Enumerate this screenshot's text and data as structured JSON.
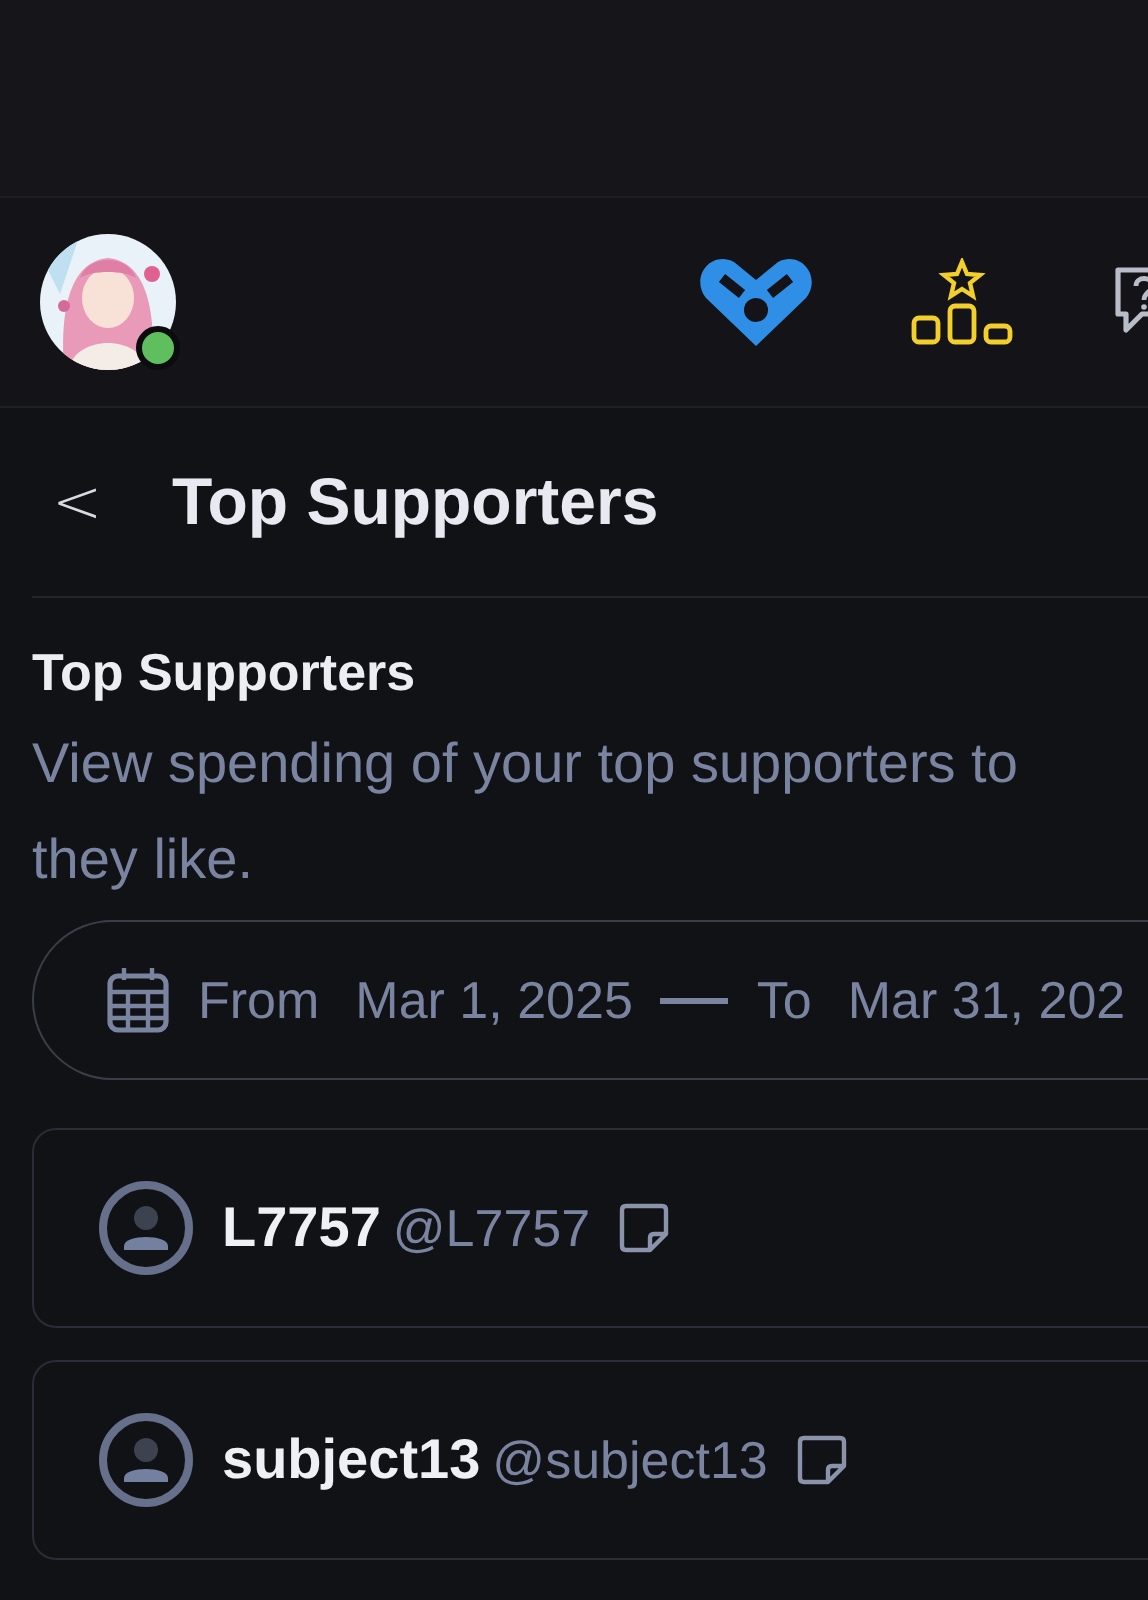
{
  "header": {
    "profile": {
      "online": true
    },
    "nav_icons": [
      {
        "kind": "heart"
      },
      {
        "kind": "podium"
      },
      {
        "kind": "help"
      }
    ]
  },
  "page_title": {
    "back": "<",
    "title": "Top Supporters"
  },
  "section": {
    "heading": "Top Supporters",
    "description": "View spending of your top supporters to they like."
  },
  "date_range": {
    "from_label": "From",
    "from": "Mar 1, 2025",
    "to_label": "To",
    "to": "Mar 31, 202"
  },
  "supporters": [
    {
      "name": "L7757",
      "handle": "@L7757"
    },
    {
      "name": "subject13",
      "handle": "@subject13"
    }
  ]
}
